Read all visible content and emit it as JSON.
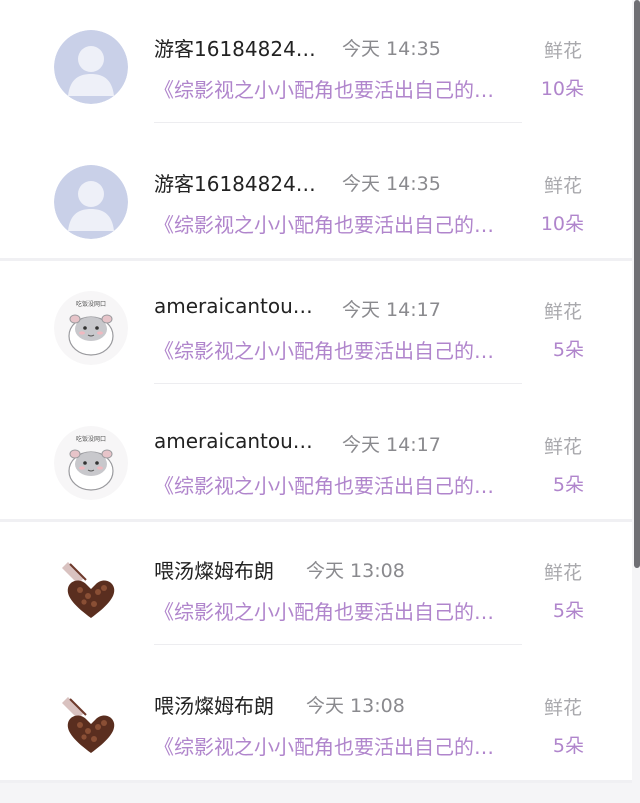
{
  "gifts": [
    {
      "name": "游客16184824…",
      "time": "今天 14:35",
      "kind": "鲜花",
      "book": "《综影视之小小配角也要活出自己的…",
      "count": "10朵",
      "avatar": "default-user-icon"
    },
    {
      "name": "游客16184824…",
      "time": "今天 14:35",
      "kind": "鲜花",
      "book": "《综影视之小小配角也要活出自己的…",
      "count": "10朵",
      "avatar": "default-user-icon"
    },
    {
      "name": "ameraicantou…",
      "time": "今天 14:17",
      "kind": "鲜花",
      "book": "《综影视之小小配角也要活出自己的…",
      "count": "5朵",
      "avatar": "hamster-avatar",
      "avatar_caption": "吃饭没网口"
    },
    {
      "name": "ameraicantou…",
      "time": "今天 14:17",
      "kind": "鲜花",
      "book": "《综影视之小小配角也要活出自己的…",
      "count": "5朵",
      "avatar": "hamster-avatar",
      "avatar_caption": "吃饭没网口"
    },
    {
      "name": "喂汤燦姆布朗",
      "time": "今天 13:08",
      "kind": "鲜花",
      "book": "《综影视之小小配角也要活出自己的…",
      "count": "5朵",
      "avatar": "coffee-heart-avatar"
    },
    {
      "name": "喂汤燦姆布朗",
      "time": "今天 13:08",
      "kind": "鲜花",
      "book": "《综影视之小小配角也要活出自己的…",
      "count": "5朵",
      "avatar": "coffee-heart-avatar"
    }
  ],
  "colors": {
    "book_accent": "#b085cc",
    "name": "#222222",
    "muted": "#8a8a8e"
  }
}
